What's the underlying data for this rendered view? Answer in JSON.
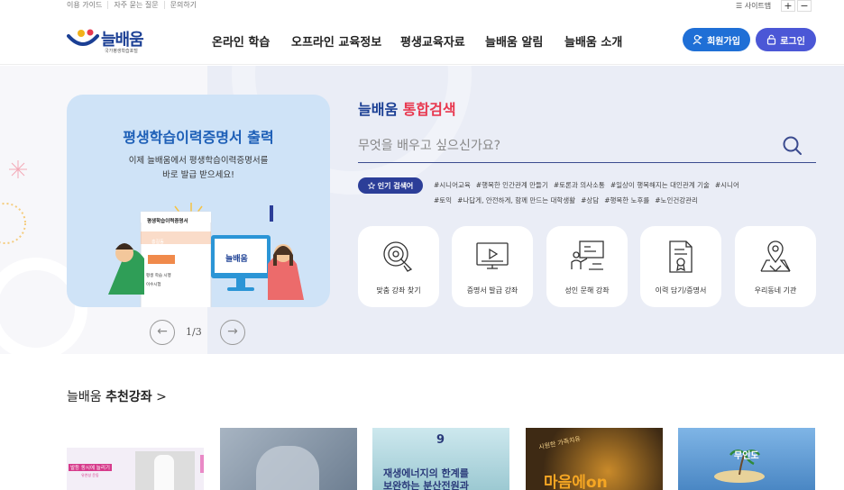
{
  "util": {
    "links": [
      "이용 가이드",
      "자주 묻는 질문",
      "문의하기"
    ],
    "sitemap": "☰ 사이트맵",
    "zoom_in": "+",
    "zoom_out": "−"
  },
  "header": {
    "logo_text": "늘배움",
    "logo_sub": "국가평생학습포털",
    "nav": [
      "온라인 학습",
      "오프라인 교육정보",
      "평생교육자료",
      "늘배움 알림",
      "늘배움 소개"
    ],
    "signup": "회원가입",
    "login": "로그인",
    "colors": {
      "brand": "#1b3f94",
      "signup_bg": "#1f6fd6",
      "login_bg": "#4b57d6"
    }
  },
  "banner": {
    "title": "평생학습이력증명서 출력",
    "sub_line1": "이제 늘배움에서 평생학습이력증명서를",
    "sub_line2": "바로 발급 받으세요!",
    "doc_title": "평생학습이력증명서",
    "doc_name": "홍길동",
    "doc_row1": "평생 학습 시행",
    "doc_row2": "이수시험",
    "screen_logo": "늘배움",
    "page_indicator": "1/3",
    "prev": "←",
    "next": "→"
  },
  "search": {
    "title_a": "늘배움 ",
    "title_b": "통합검색",
    "placeholder": "무엇을 배우고 싶으신가요?",
    "popular_label": "인기 검색어",
    "tags": [
      "#시니어교육",
      "#행복한 인간관계 만들기",
      "#토론과 의사소통",
      "#일상이 행복해지는 대인관계 기술",
      "#시니어",
      "#토익",
      "#나답게, 안전하게, 함께 만드는 대학생활",
      "#상담",
      "#행복한 노후를",
      "#노인건강관리"
    ]
  },
  "quick": [
    {
      "label": "맞춤 강좌 찾기",
      "icon": "target-search-icon"
    },
    {
      "label": "증명서 발급 강좌",
      "icon": "monitor-play-icon"
    },
    {
      "label": "성인 문해 강좌",
      "icon": "classroom-icon"
    },
    {
      "label": "이력 담기/증명서",
      "icon": "certificate-icon"
    },
    {
      "label": "우리동네 기관",
      "icon": "map-pin-icon"
    }
  ],
  "recommend": {
    "title_a": "늘배움 ",
    "title_b": "추천강좌",
    "arrow": ">",
    "thumb1_text": "발등 동시에 늘리기",
    "thumb1_sub": "유연성 운동",
    "thumb3_num": "9",
    "thumb3_text1": "재생에너지의 한계를",
    "thumb3_text2": "보완하는 분산전원과",
    "thumb4_text": "마음에on",
    "thumb4_script": "시원한 가족치유",
    "thumb5_text": "무인도"
  }
}
